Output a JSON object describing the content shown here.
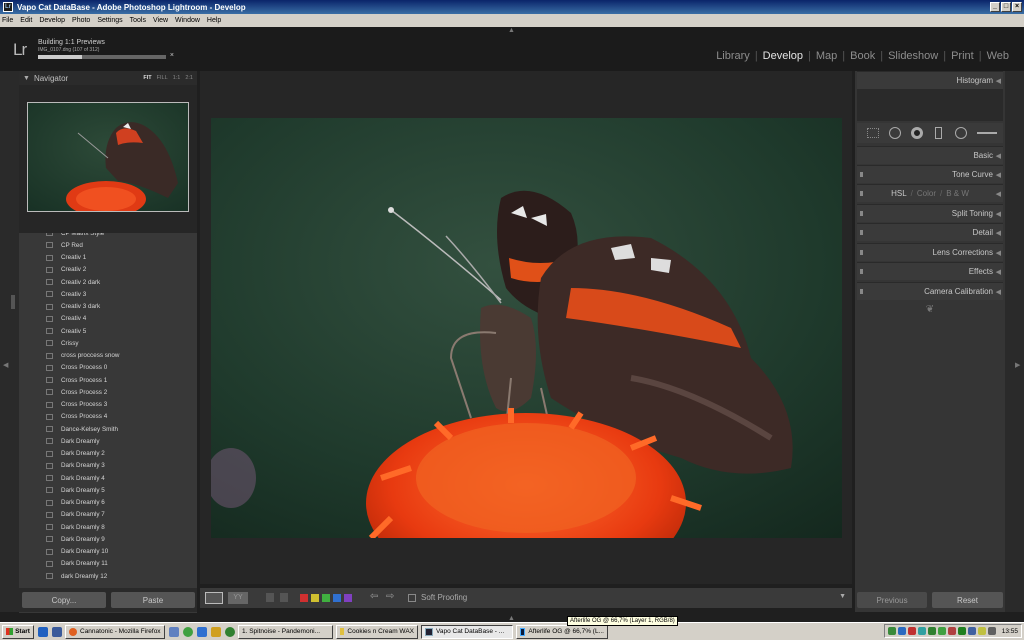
{
  "window": {
    "title": "Vapo Cat DataBase - Adobe Photoshop Lightroom - Develop",
    "buttons": [
      "_",
      "□",
      "×"
    ]
  },
  "menu": [
    "File",
    "Edit",
    "Develop",
    "Photo",
    "Settings",
    "Tools",
    "View",
    "Window",
    "Help"
  ],
  "header": {
    "logo": "Lr",
    "status_title": "Building 1:1 Previews",
    "status_sub": "IMG_0107.dng (107 of 312)",
    "progress_fraction": 0.34,
    "cancel": "×",
    "modules": [
      "Library",
      "Develop",
      "Map",
      "Book",
      "Slideshow",
      "Print",
      "Web"
    ],
    "active_module": "Develop"
  },
  "navigator": {
    "title": "Navigator",
    "zoom": [
      "FIT",
      "FILL",
      "1:1",
      "2:1"
    ],
    "active_zoom": "FIT"
  },
  "presets": [
    "CP Matrix Style",
    "CP Red",
    "Creativ 1",
    "Creativ 2",
    "Creativ 2 dark",
    "Creativ 3",
    "Creativ 3 dark",
    "Creativ 4",
    "Creativ 5",
    "Crissy",
    "cross proccess snow",
    "Cross Process 0",
    "Cross Process 1",
    "Cross Process 2",
    "Cross Process 3",
    "Cross Process 4",
    "Dance-Kelsey Smith",
    "Dark Dreamly",
    "Dark Dreamly 2",
    "Dark Dreamly 3",
    "Dark Dreamly 4",
    "Dark Dreamly 5",
    "Dark Dreamly 6",
    "Dark Dreamly 7",
    "Dark Dreamly 8",
    "Dark Dreamly 9",
    "Dark Dreamly 10",
    "Dark Dreamly 11",
    "dark Dreamly 12"
  ],
  "left_buttons": {
    "copy": "Copy...",
    "paste": "Paste"
  },
  "toolbar": {
    "view_label": "YY",
    "soft_proofing": "Soft Proofing",
    "color_labels": [
      "#d03030",
      "#d0c030",
      "#40b040",
      "#3070d0",
      "#8040c0"
    ]
  },
  "right_panel": {
    "sections": [
      "Histogram",
      "Basic",
      "Tone Curve",
      "HSL",
      "Color",
      "B & W",
      "Split Toning",
      "Detail",
      "Lens Corrections",
      "Effects",
      "Camera Calibration"
    ],
    "hsl_sep": "/",
    "ornament": "❦"
  },
  "right_buttons": {
    "previous": "Previous",
    "reset": "Reset"
  },
  "taskbar": {
    "start": "Start",
    "tasks": [
      "Cannatonic - Mozilla Firefox",
      "1. Spitnoise - Pandemoni...",
      "Cookies n Cream WAX",
      "Vapo Cat DataBase - ...",
      "Afterlife OG @ 66,7% (L..."
    ],
    "active_task": "Vapo Cat DataBase - ...",
    "clock": "13:55",
    "tooltip": "Afterlife OG @ 66,7% (Layer 1, RGB/8)"
  }
}
